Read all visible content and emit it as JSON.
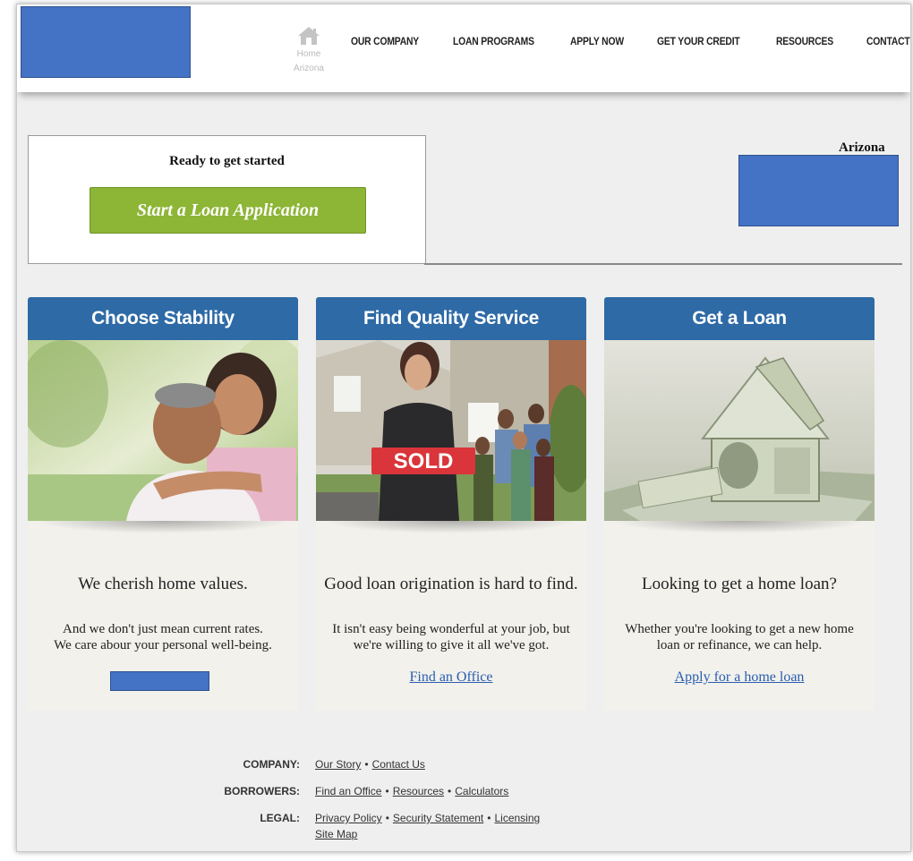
{
  "header": {
    "home_label_line1": "Home",
    "home_label_line2": "Arizona",
    "nav": [
      "OUR COMPANY",
      "LOAN PROGRAMS",
      "APPLY NOW",
      "GET YOUR CREDIT",
      "RESOURCES",
      "CONTACT US"
    ]
  },
  "cta": {
    "ready_text": "Ready to get started",
    "start_button": "Start a Loan Application"
  },
  "state_label": "Arizona",
  "cards": [
    {
      "title": "Choose Stability",
      "heading": "We cherish home values.",
      "body_line1": "And we don't just mean current rates.",
      "body_line2": "We care abour your personal well-being.",
      "link": ""
    },
    {
      "title": "Find Quality Service",
      "heading": "Good loan origination is hard to find.",
      "body_line1": "It isn't easy being wonderful at your job, but",
      "body_line2": "we're willing to give it all we've got.",
      "link": "Find an Office",
      "sign_text": "SOLD"
    },
    {
      "title": "Get a Loan",
      "heading": "Looking to get a home loan?",
      "body_line1": "Whether you're looking to get a new home",
      "body_line2": "loan or refinance, we can help.",
      "link": "Apply for a home loan"
    }
  ],
  "footer": {
    "company_label": "COMPANY:",
    "company_links": [
      "Our Story",
      "Contact Us"
    ],
    "borrowers_label": "BORROWERS:",
    "borrowers_links": [
      "Find an Office",
      "Resources",
      "Calculators"
    ],
    "legal_label": "LEGAL:",
    "legal_links": [
      "Privacy Policy",
      "Security Statement",
      "Licensing"
    ],
    "sitemap": "Site Map",
    "separator": "•"
  },
  "colors": {
    "accent_blue": "#2e6aa6",
    "cta_green": "#8db536",
    "redaction_blue": "#4472c4",
    "link_blue": "#2a5db0"
  }
}
